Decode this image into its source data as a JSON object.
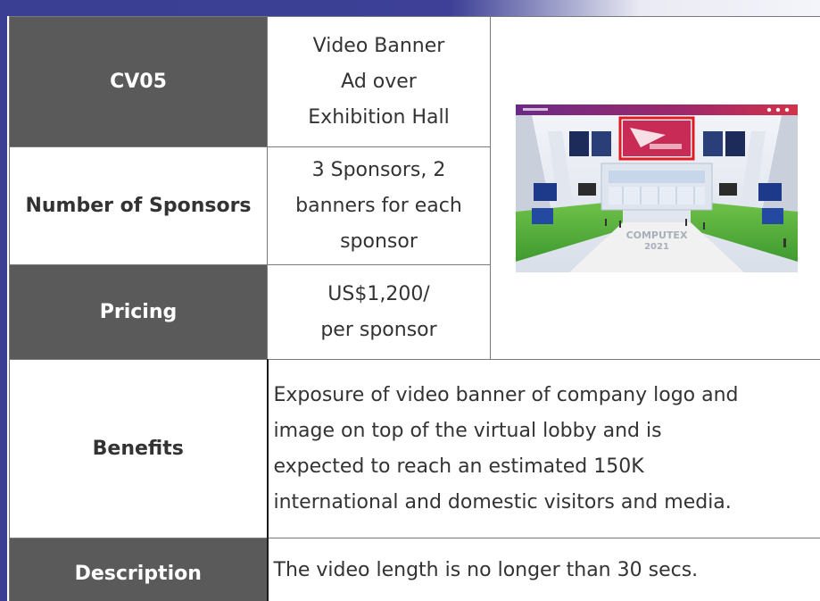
{
  "table": {
    "code": "CV05",
    "title_lines": [
      "Video Banner",
      "Ad over",
      "Exhibition Hall"
    ],
    "sponsors_label": "Number of Sponsors",
    "sponsors_lines": [
      "3 Sponsors, 2",
      "banners for each",
      "sponsor"
    ],
    "pricing_label": "Pricing",
    "pricing_lines": [
      "US$1,200/",
      "per sponsor"
    ],
    "benefits_label": "Benefits",
    "benefits_lines": [
      "Exposure of video banner of company logo and",
      "image on top of the virtual lobby and is",
      "expected to reach an estimated 150K",
      "international and domestic visitors and media."
    ],
    "description_label": "Description",
    "description_text": "The video length is no longer than 30 secs."
  },
  "thumbnail": {
    "banner_text": "COMPUTEX 2021",
    "highlight_color": "#e11b22",
    "top_bar_color": "#7a2a8a"
  },
  "colors": {
    "label_bg": "#5a5a5a",
    "band": "#3a3f93"
  }
}
